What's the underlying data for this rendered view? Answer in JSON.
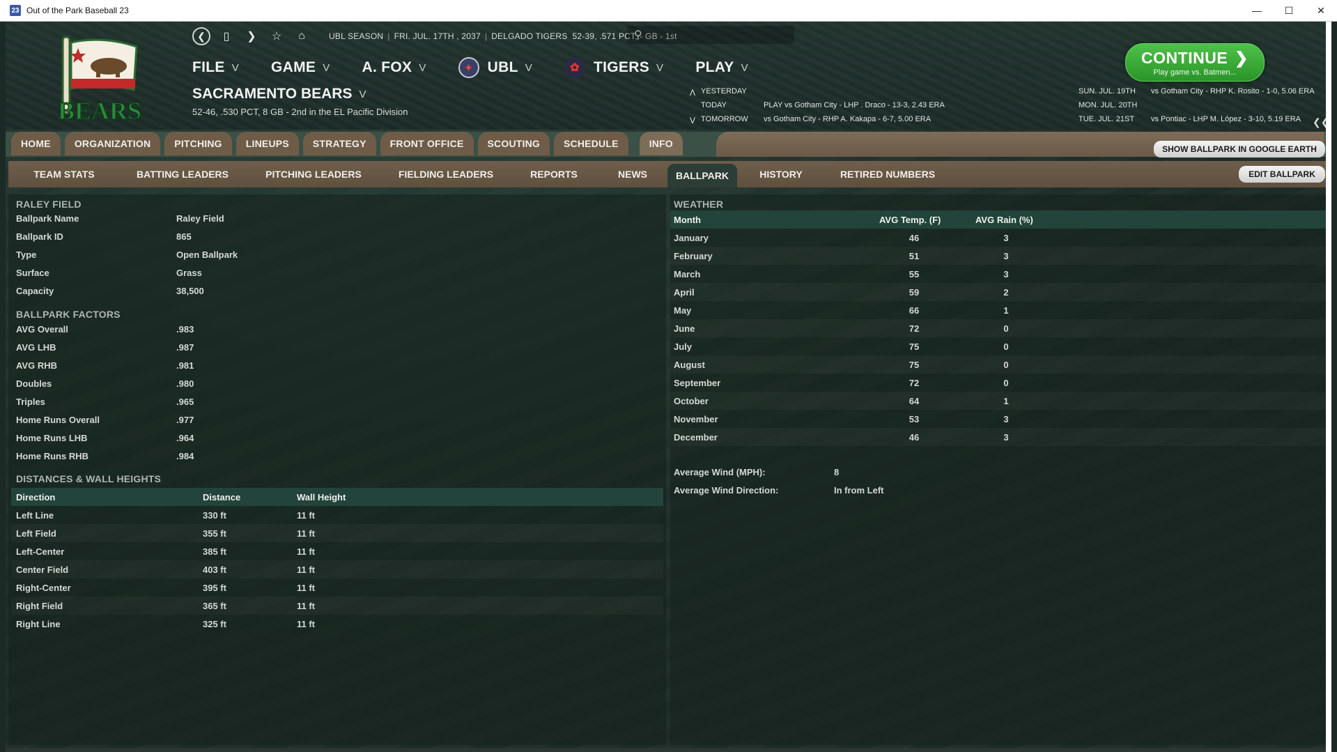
{
  "window": {
    "title": "Out of the Park Baseball 23",
    "icon_text": "23",
    "controls": [
      "minimize",
      "maximize",
      "close"
    ]
  },
  "toolbar": {
    "season": "UBL SEASON",
    "date": "FRI. JUL. 17TH , 2037",
    "opponent_team": "DELGADO TIGERS",
    "opponent_record": "52-39, .571 PCT, - GB - 1st"
  },
  "main_menu": {
    "file": "FILE",
    "game": "GAME",
    "manager": "A. FOX",
    "league": "UBL",
    "team": "TIGERS",
    "play": "PLAY"
  },
  "team": {
    "name": "SACRAMENTO BEARS",
    "record": "52-46, .530 PCT, 8 GB - 2nd in the EL Pacific Division"
  },
  "schedule": {
    "yesterday_label": "YESTERDAY",
    "today_label": "TODAY",
    "today_text": "PLAY vs Gotham City - LHP  . Draco - 13-3, 2.43 ERA",
    "tomorrow_label": "TOMORROW",
    "tomorrow_text": "vs Gotham City - RHP A. Kakapa - 6-7, 5.00 ERA",
    "upcoming": [
      {
        "date": "SUN. JUL. 19TH",
        "text": "vs Gotham City - RHP K. Rosito - 1-0, 5.06 ERA"
      },
      {
        "date": "MON. JUL. 20TH",
        "text": ""
      },
      {
        "date": "TUE. JUL. 21ST",
        "text": "vs Pontiac - LHP M. López - 3-10, 5.19 ERA"
      }
    ]
  },
  "continue_button": {
    "label": "CONTINUE",
    "sub": "Play game vs. Batmen..."
  },
  "nav_tabs": [
    "HOME",
    "ORGANIZATION",
    "PITCHING",
    "LINEUPS",
    "STRATEGY",
    "FRONT OFFICE",
    "SCOUTING",
    "SCHEDULE",
    "INFO"
  ],
  "nav_active": "INFO",
  "sub_tabs": [
    "TEAM STATS",
    "BATTING LEADERS",
    "PITCHING LEADERS",
    "FIELDING LEADERS",
    "REPORTS",
    "NEWS",
    "BALLPARK",
    "HISTORY",
    "RETIRED NUMBERS"
  ],
  "sub_active": "BALLPARK",
  "buttons": {
    "google_earth": "SHOW BALLPARK IN GOOGLE EARTH",
    "edit_ballpark": "EDIT BALLPARK"
  },
  "ballpark": {
    "section_title": "RALEY FIELD",
    "info": [
      {
        "key": "Ballpark Name",
        "value": "Raley Field"
      },
      {
        "key": "Ballpark ID",
        "value": "865"
      },
      {
        "key": "Type",
        "value": "Open Ballpark"
      },
      {
        "key": "Surface",
        "value": "Grass"
      },
      {
        "key": "Capacity",
        "value": "38,500"
      }
    ]
  },
  "factors": {
    "section_title": "BALLPARK FACTORS",
    "rows": [
      {
        "key": "AVG Overall",
        "value": ".983"
      },
      {
        "key": "AVG LHB",
        "value": ".987"
      },
      {
        "key": "AVG RHB",
        "value": ".981"
      },
      {
        "key": "Doubles",
        "value": ".980"
      },
      {
        "key": "Triples",
        "value": ".965"
      },
      {
        "key": "Home Runs Overall",
        "value": ".977"
      },
      {
        "key": "Home Runs LHB",
        "value": ".964"
      },
      {
        "key": "Home Runs RHB",
        "value": ".984"
      }
    ]
  },
  "distances": {
    "section_title": "DISTANCES & WALL HEIGHTS",
    "headers": [
      "Direction",
      "Distance",
      "Wall Height"
    ],
    "rows": [
      [
        "Left Line",
        "330 ft",
        "11 ft"
      ],
      [
        "Left Field",
        "355 ft",
        "11 ft"
      ],
      [
        "Left-Center",
        "385 ft",
        "11 ft"
      ],
      [
        "Center Field",
        "403 ft",
        "11 ft"
      ],
      [
        "Right-Center",
        "395 ft",
        "11 ft"
      ],
      [
        "Right Field",
        "365 ft",
        "11 ft"
      ],
      [
        "Right Line",
        "325 ft",
        "11 ft"
      ]
    ]
  },
  "weather": {
    "section_title": "WEATHER",
    "headers": [
      "Month",
      "AVG Temp. (F)",
      "AVG Rain (%)"
    ],
    "rows": [
      [
        "January",
        "46",
        "3"
      ],
      [
        "February",
        "51",
        "3"
      ],
      [
        "March",
        "55",
        "3"
      ],
      [
        "April",
        "59",
        "2"
      ],
      [
        "May",
        "66",
        "1"
      ],
      [
        "June",
        "72",
        "0"
      ],
      [
        "July",
        "75",
        "0"
      ],
      [
        "August",
        "75",
        "0"
      ],
      [
        "September",
        "72",
        "0"
      ],
      [
        "October",
        "64",
        "1"
      ],
      [
        "November",
        "53",
        "3"
      ],
      [
        "December",
        "46",
        "3"
      ]
    ],
    "avg_wind_label": "Average Wind (MPH):",
    "avg_wind_value": "8",
    "wind_dir_label": "Average Wind Direction:",
    "wind_dir_value": "In from Left"
  },
  "colors": {
    "continue_green": "#3aab36",
    "tab_brown": "#6e5c49",
    "table_header": "#22443a"
  }
}
